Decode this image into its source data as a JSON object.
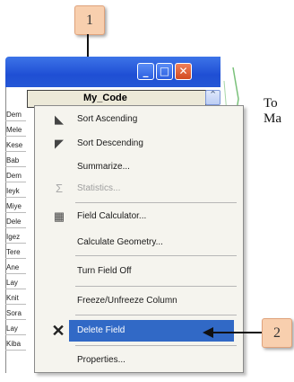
{
  "callouts": {
    "c1": "1",
    "c2": "2"
  },
  "window": {
    "buttons": {
      "minimize": "_",
      "maximize": "□",
      "close": "✕"
    },
    "column_header": "My_Code",
    "scroll_up_glyph": "⌃"
  },
  "table": {
    "rows": [
      "Dem",
      "Mele",
      "Kese",
      "Bab",
      "Dem",
      "Ieyk",
      "Miye",
      "Dele",
      "Igez",
      "Tere",
      "Ane",
      "Lay",
      "Knit",
      "Sora",
      "Lay",
      "Kiba"
    ]
  },
  "menu": {
    "items": [
      {
        "label": "Sort Ascending",
        "icon": "sort-ascending-icon"
      },
      {
        "label": "Sort Descending",
        "icon": "sort-descending-icon"
      },
      {
        "label": "Summarize...",
        "icon": ""
      },
      {
        "label": "Statistics...",
        "icon": "sigma-icon",
        "disabled": true
      },
      {
        "label": "Field Calculator...",
        "icon": "calculator-icon"
      },
      {
        "label": "Calculate Geometry...",
        "icon": ""
      },
      {
        "label": "Turn Field Off",
        "icon": ""
      },
      {
        "label": "Freeze/Unfreeze Column",
        "icon": ""
      },
      {
        "label": "Delete Field",
        "icon": "delete-x-icon",
        "selected": true
      },
      {
        "label": "Properties...",
        "icon": ""
      }
    ]
  },
  "side_text": {
    "line1": "To",
    "line2": "Ma"
  },
  "colors": {
    "titlebar": "#1f4fd4",
    "selection": "#3169c6",
    "callout": "#f8cfae"
  }
}
